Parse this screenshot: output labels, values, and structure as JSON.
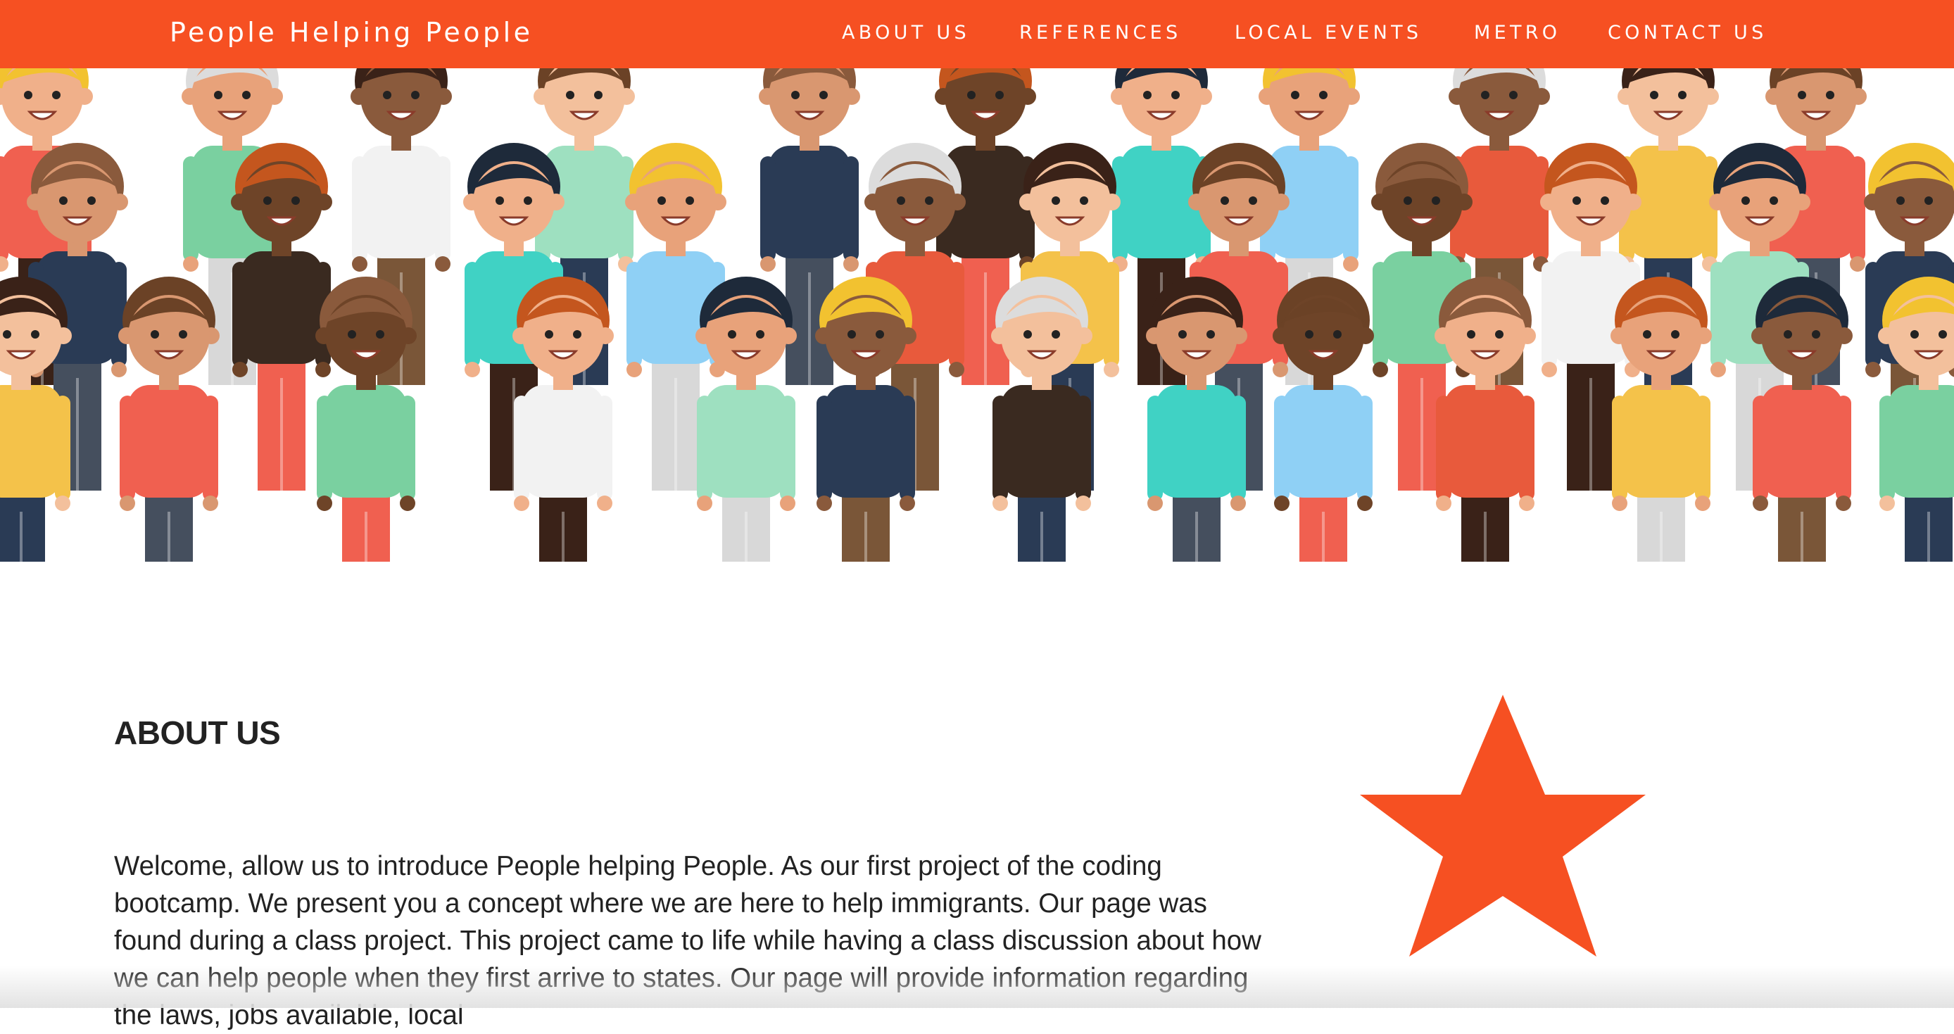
{
  "navbar": {
    "brand": "People Helping People",
    "links": [
      "ABOUT US",
      "REFERENCES",
      "LOCAL EVENTS",
      "METRO",
      "CONTACT US"
    ],
    "background_color": "#f65022"
  },
  "hero": {
    "image": "crowd-of-diverse-people-illustration"
  },
  "about": {
    "title": "ABOUT US",
    "text": "Welcome, allow us to introduce People helping People. As our first project of the coding bootcamp. We present you a concept where we are here to help immigrants. Our page was found during a class project. This project came to life while having a class discussion about how we can help people when they first arrive to states. Our page will provide information regarding the laws, jobs available, local",
    "icon": "star-icon",
    "accent_color": "#f65022"
  }
}
